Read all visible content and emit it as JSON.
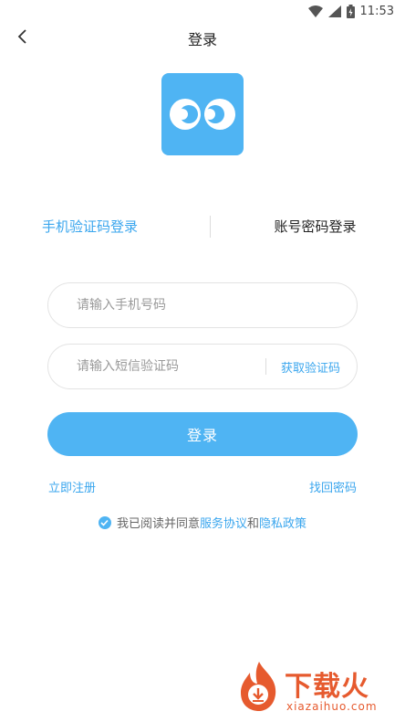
{
  "status_bar": {
    "time": "11:53"
  },
  "nav": {
    "title": "登录"
  },
  "tabs": [
    {
      "label": "手机验证码登录",
      "active": true
    },
    {
      "label": "账号密码登录",
      "active": false
    }
  ],
  "form": {
    "phone_placeholder": "请输入手机号码",
    "code_placeholder": "请输入短信验证码",
    "get_code_label": "获取验证码",
    "login_label": "登录"
  },
  "links": {
    "register": "立即注册",
    "forgot": "找回密码"
  },
  "agreement": {
    "prefix": "我已阅读并同意",
    "service": "服务协议",
    "and": "和",
    "privacy": "隐私政策",
    "checked": true
  },
  "watermark": {
    "text": "下载火",
    "domain": "xiazaihuo.com"
  },
  "colors": {
    "accent": "#4fb4f3",
    "link": "#3aa6ee",
    "watermark": "#e65a2e"
  }
}
